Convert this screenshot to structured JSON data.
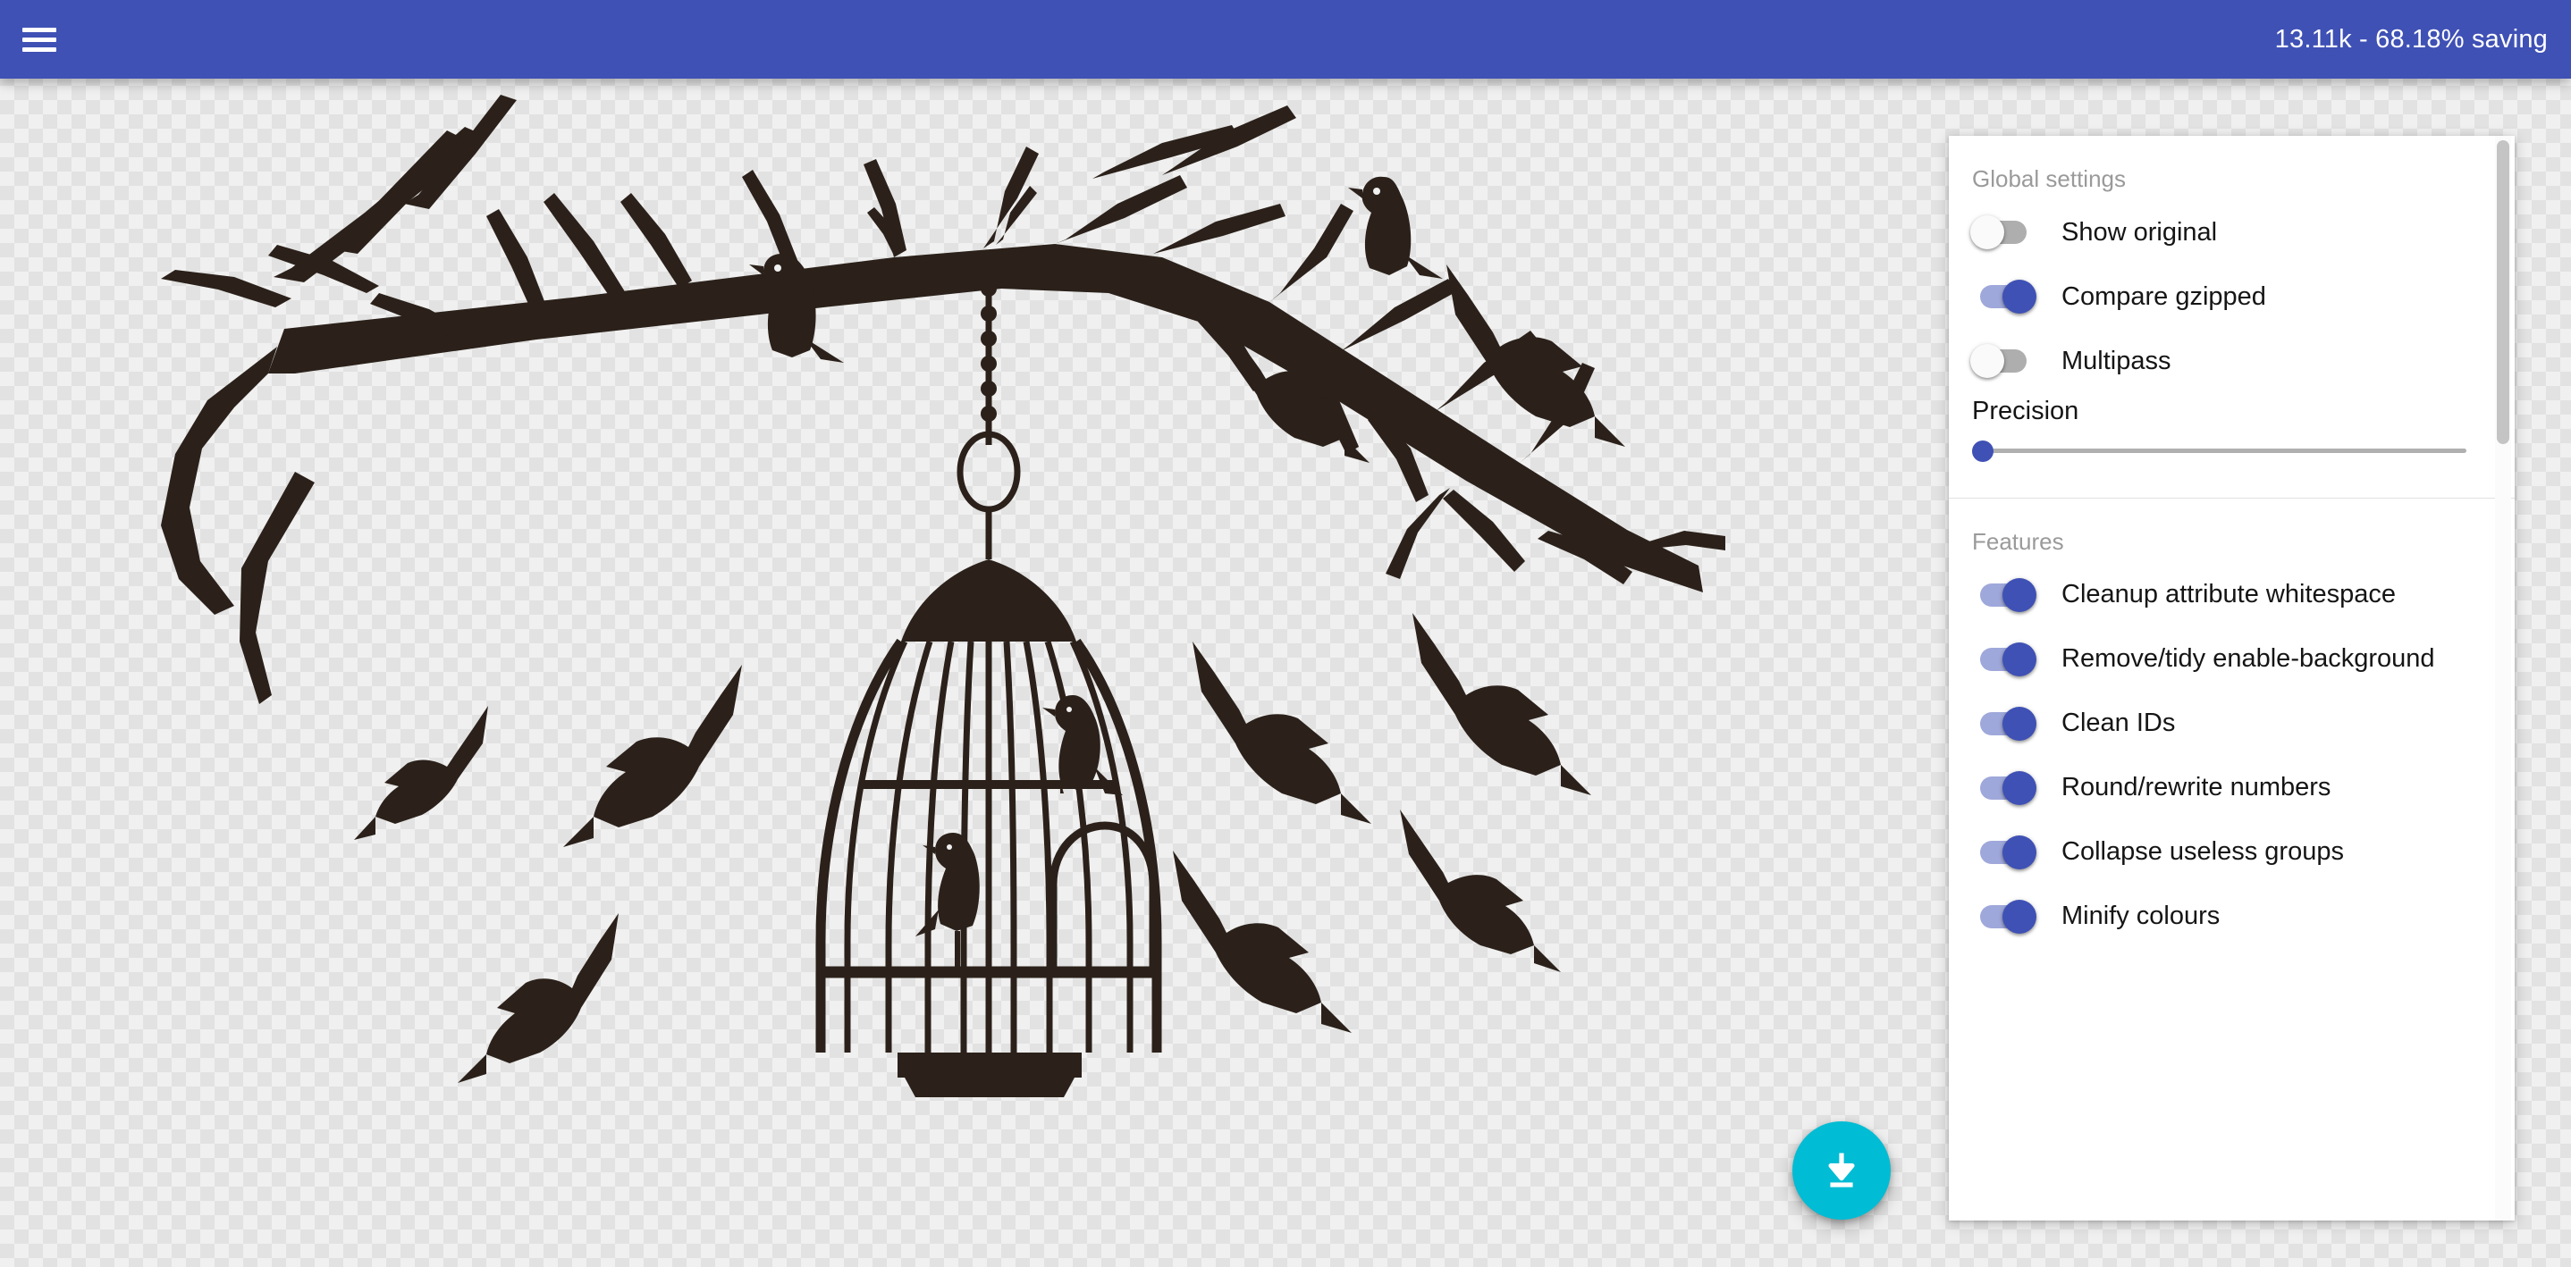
{
  "topbar": {
    "menu_icon": "hamburger-menu-icon",
    "savings_text": "13.11k - 68.18% saving",
    "background_color": "#3f51b5",
    "text_color": "#ffffff"
  },
  "canvas": {
    "artwork_description": "Black silhouette of a tree branch with an open birdcage hanging from it and birds flying away",
    "artwork_color": "#2b211a",
    "background": "transparency-checkerboard",
    "checker_light": "#f0f0f0",
    "checker_dark": "#e2e2e2"
  },
  "download": {
    "icon": "download-arrow-icon",
    "color": "#00bcd4"
  },
  "settings": {
    "accent_color": "#3f51b5",
    "track_on_color": "#9fa8da",
    "track_off_color": "#aeaeae",
    "sections": [
      {
        "title": "Global settings",
        "toggles": [
          {
            "label": "Show original",
            "on": false
          },
          {
            "label": "Compare gzipped",
            "on": true
          },
          {
            "label": "Multipass",
            "on": false
          }
        ],
        "slider": {
          "label": "Precision",
          "value": 0,
          "min": 0,
          "max": 8
        }
      },
      {
        "title": "Features",
        "toggles": [
          {
            "label": "Cleanup attribute whitespace",
            "on": true
          },
          {
            "label": "Remove/tidy enable-background",
            "on": true
          },
          {
            "label": "Clean IDs",
            "on": true
          },
          {
            "label": "Round/rewrite numbers",
            "on": true
          },
          {
            "label": "Collapse useless groups",
            "on": true
          },
          {
            "label": "Minify colours",
            "on": true
          }
        ]
      }
    ]
  }
}
